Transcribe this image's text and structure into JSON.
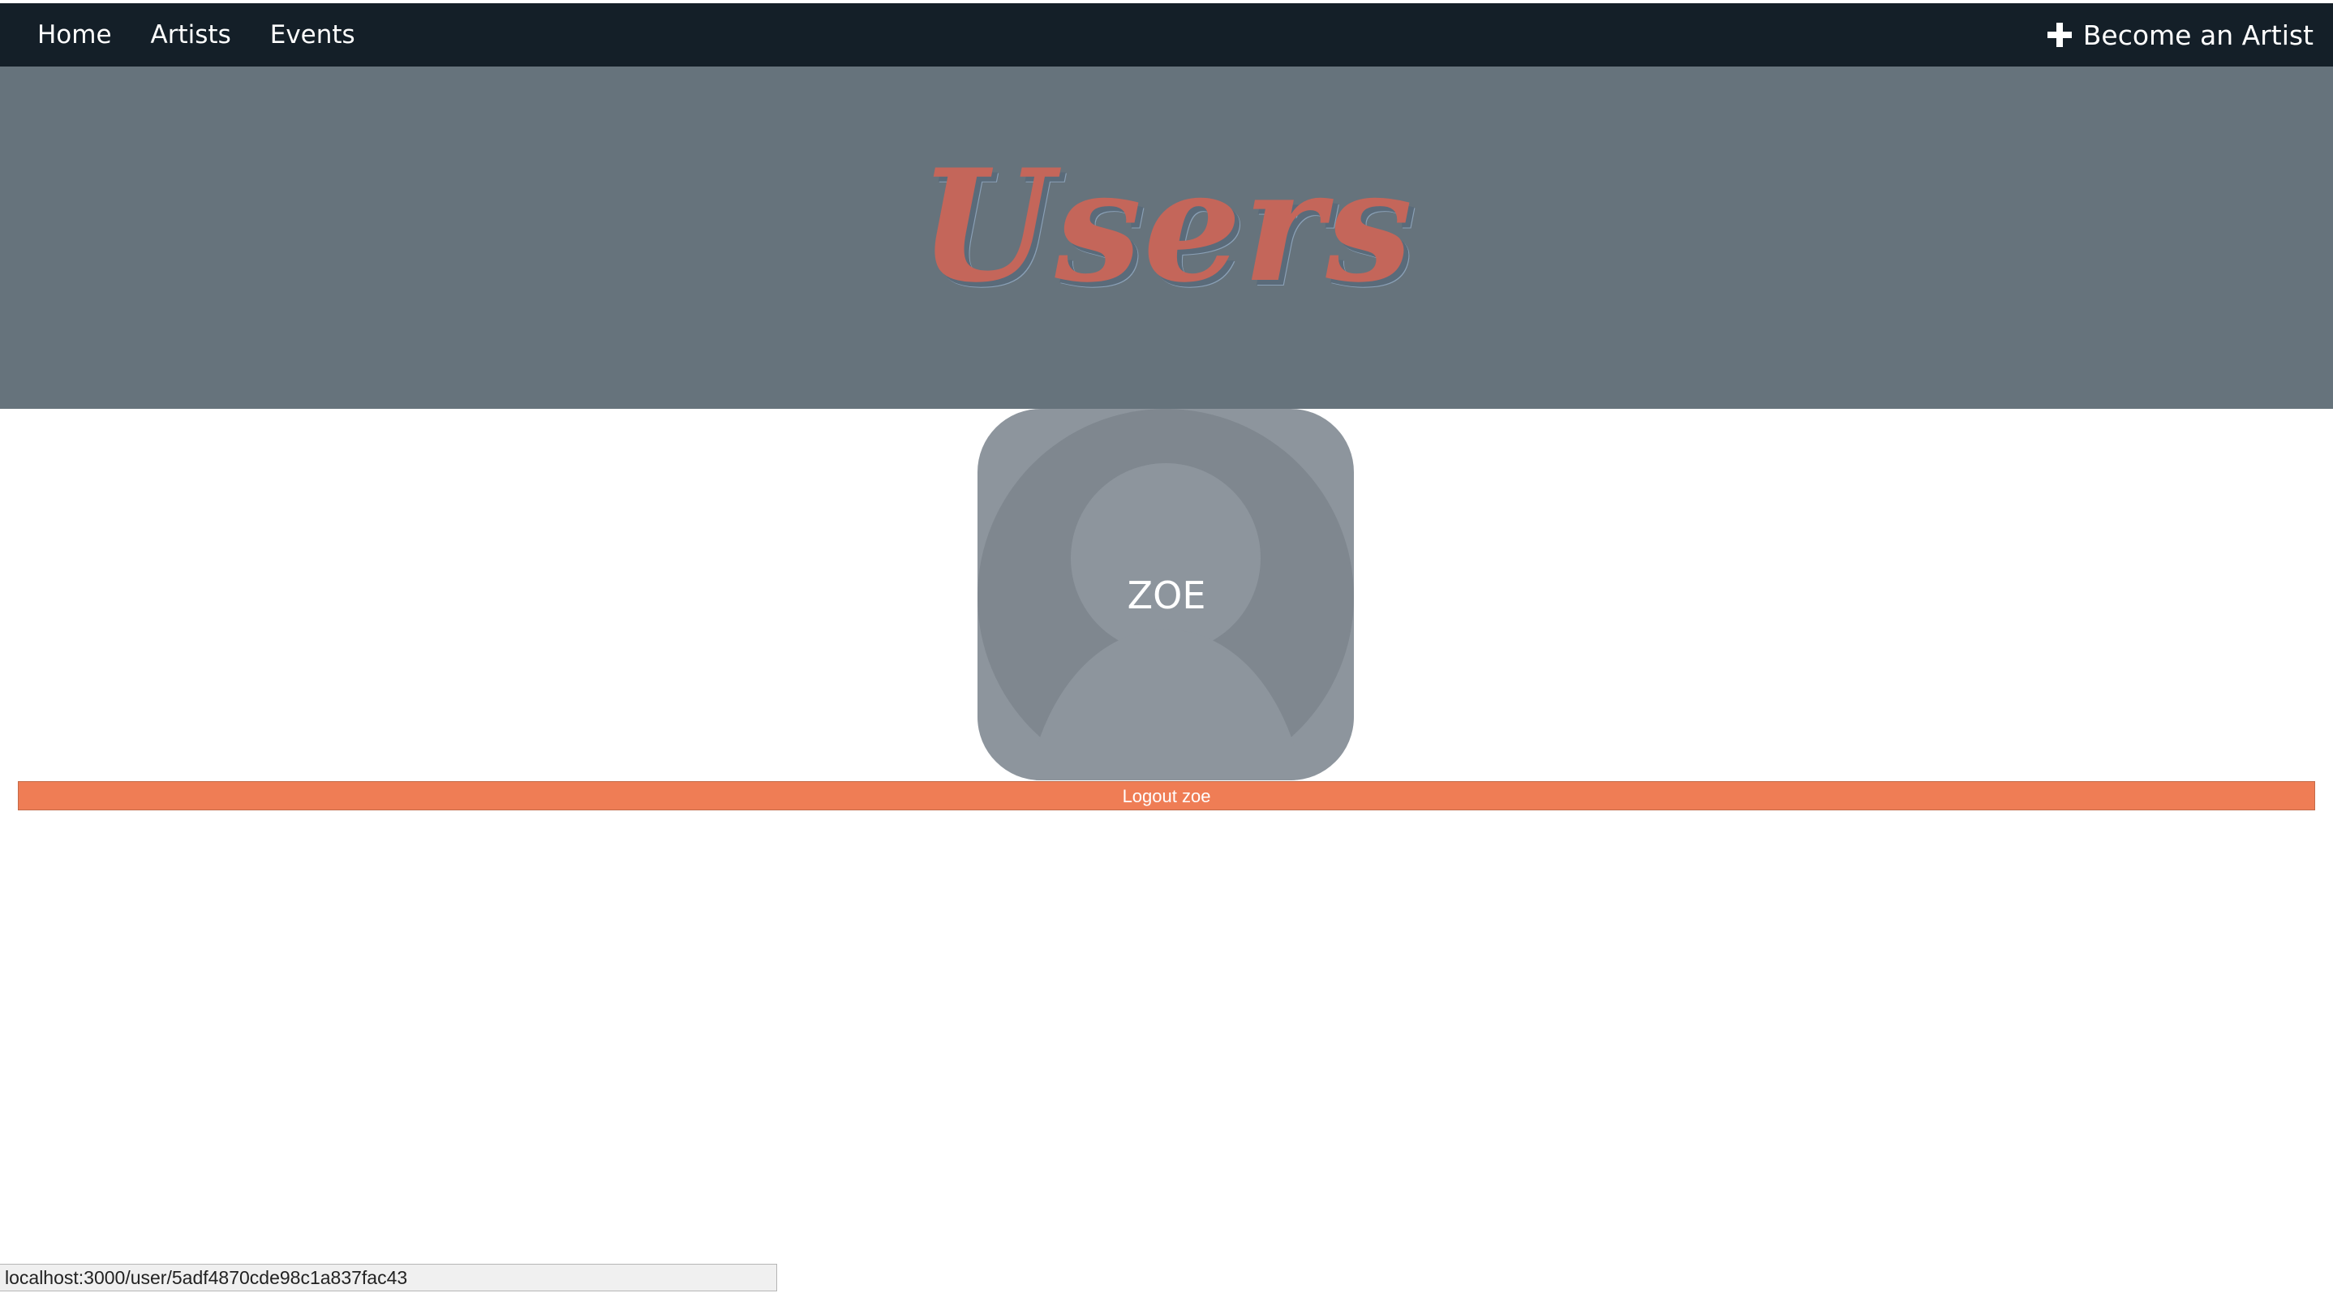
{
  "nav": {
    "links": [
      {
        "label": "Home"
      },
      {
        "label": "Artists"
      },
      {
        "label": "Events"
      }
    ],
    "become_artist_label": "Become an Artist",
    "become_artist_icon": "plus-icon"
  },
  "hero": {
    "title": "Users"
  },
  "user_card": {
    "name": "ZOE",
    "avatar_icon": "user-silhouette-icon"
  },
  "logout": {
    "label": "Logout zoe"
  },
  "status_bar": {
    "url": "localhost:3000/user/5adf4870cde98c1a837fac43"
  },
  "colors": {
    "navbar": "#141f28",
    "hero_background": "#66737c",
    "hero_title": "#c4665a",
    "avatar_card": "#8d959d",
    "logout_button": "#ef7d55"
  }
}
